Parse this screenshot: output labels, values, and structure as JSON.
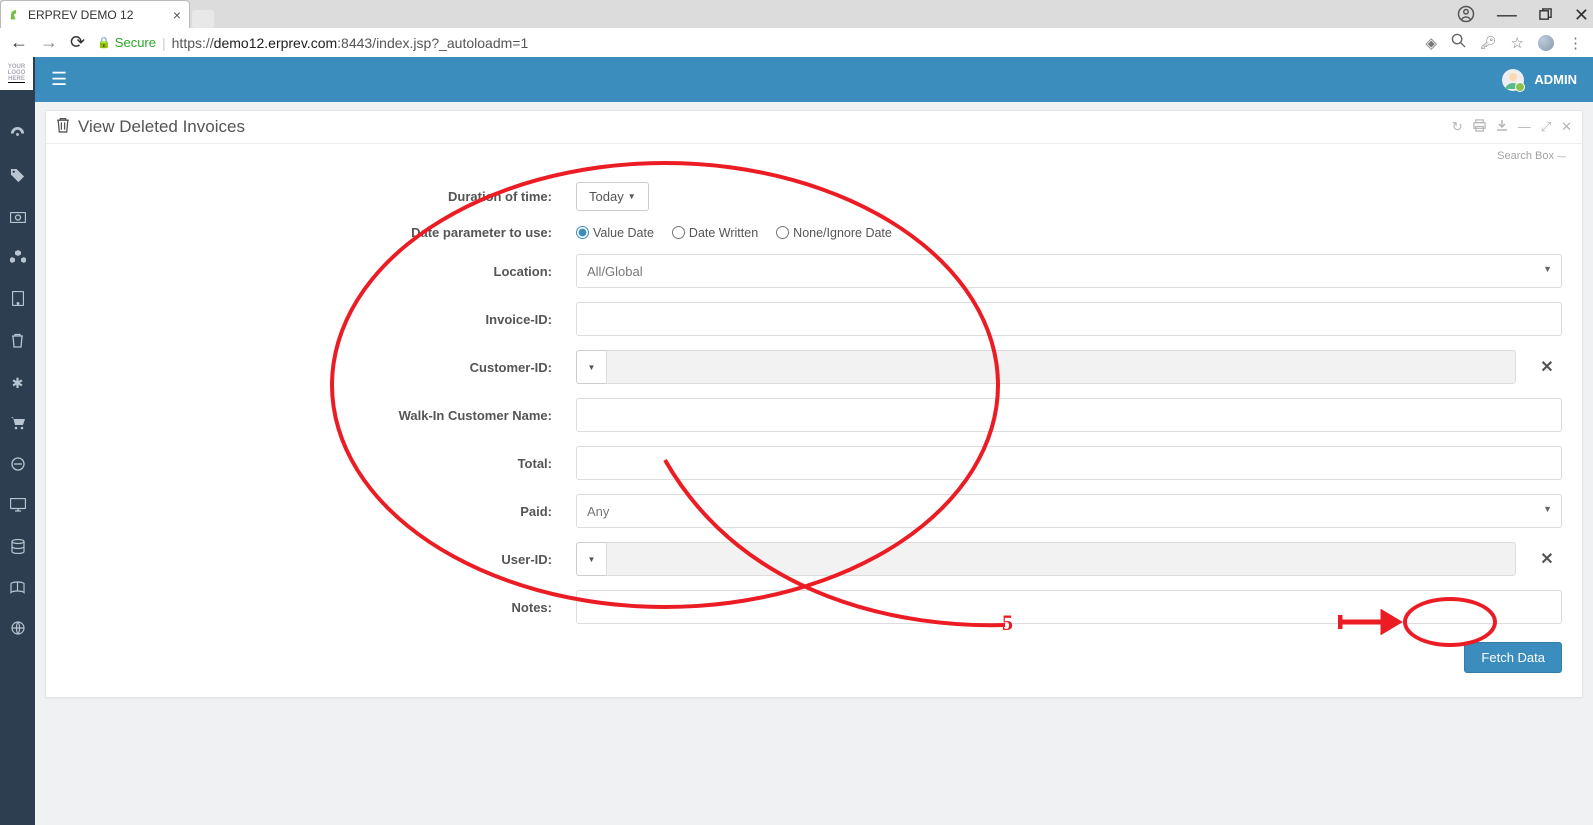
{
  "browser": {
    "tab_title": "ERPREV DEMO 12",
    "secure_label": "Secure",
    "url_prefix": "https://",
    "url_host": "demo12.erprev.com",
    "url_rest": ":8443/index.jsp?_autoloadm=1"
  },
  "topbar": {
    "user_label": "ADMIN"
  },
  "logo": {
    "line1": "YOUR",
    "line2": "LOGO",
    "line3": "HERE"
  },
  "panel": {
    "title": "View Deleted Invoices",
    "search_box_label": "Search Box"
  },
  "form": {
    "duration_label": "Duration of time:",
    "duration_value": "Today",
    "date_param_label": "Date parameter to use:",
    "radios": {
      "value_date": "Value Date",
      "date_written": "Date Written",
      "none": "None/Ignore Date"
    },
    "location_label": "Location:",
    "location_value": "All/Global",
    "invoice_id_label": "Invoice-ID:",
    "customer_id_label": "Customer-ID:",
    "walkin_label": "Walk-In Customer Name:",
    "total_label": "Total:",
    "paid_label": "Paid:",
    "paid_value": "Any",
    "user_id_label": "User-ID:",
    "notes_label": "Notes:",
    "fetch_button": "Fetch Data"
  },
  "annotation": {
    "number": "5"
  }
}
